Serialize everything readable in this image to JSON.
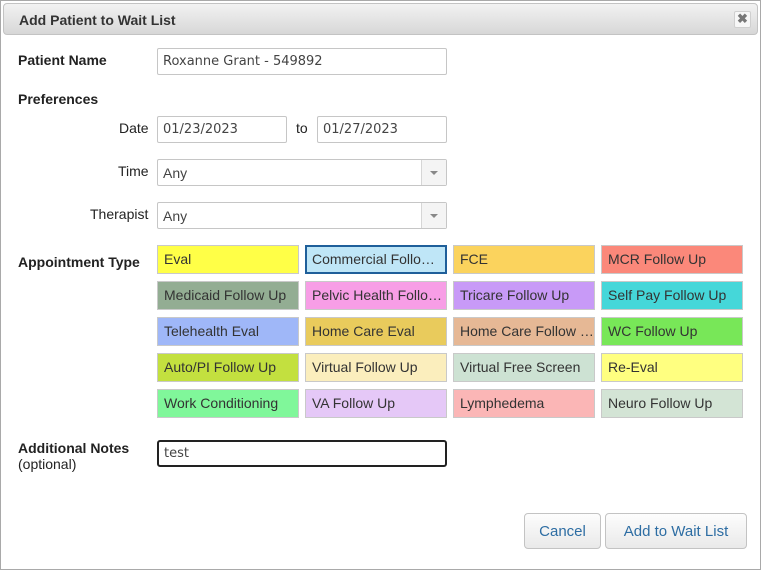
{
  "dialog": {
    "title": "Add Patient to Wait List",
    "close_glyph": "✖"
  },
  "patient": {
    "label": "Patient Name",
    "value": "Roxanne Grant - 549892"
  },
  "preferences": {
    "heading": "Preferences",
    "date_label": "Date",
    "date_from": "01/23/2023",
    "date_sep": "to",
    "date_to": "01/27/2023",
    "time_label": "Time",
    "time_value": "Any",
    "therapist_label": "Therapist",
    "therapist_value": "Any"
  },
  "appointment": {
    "label": "Appointment Type",
    "selected": "Commercial Follow Up",
    "types": [
      {
        "label": "Eval",
        "color": "#ffff47"
      },
      {
        "label": "Commercial Follow Up",
        "color": "#bfe6f7"
      },
      {
        "label": "FCE",
        "color": "#fbd35d"
      },
      {
        "label": "MCR Follow Up",
        "color": "#fb887a"
      },
      {
        "label": "Medicaid Follow Up",
        "color": "#93ad93"
      },
      {
        "label": "Pelvic Health Follow Up",
        "color": "#f79ee6"
      },
      {
        "label": "Tricare Follow Up",
        "color": "#c89af7"
      },
      {
        "label": "Self Pay Follow Up",
        "color": "#45d7d9"
      },
      {
        "label": "Telehealth Eval",
        "color": "#9fb7f8"
      },
      {
        "label": "Home Care Eval",
        "color": "#e9cb5c"
      },
      {
        "label": "Home Care Follow Up",
        "color": "#e6b895"
      },
      {
        "label": "WC Follow Up",
        "color": "#78e758"
      },
      {
        "label": "Auto/PI Follow Up",
        "color": "#c3e03f"
      },
      {
        "label": "Virtual Follow Up",
        "color": "#fbeebd"
      },
      {
        "label": "Virtual Free Screen",
        "color": "#cde2d3"
      },
      {
        "label": "Re-Eval",
        "color": "#ffff80"
      },
      {
        "label": "Work Conditioning",
        "color": "#80f79a"
      },
      {
        "label": "VA Follow Up",
        "color": "#e5c8f7"
      },
      {
        "label": "Lymphedema",
        "color": "#fbb6b6"
      },
      {
        "label": "Neuro Follow Up",
        "color": "#d3e4d5"
      }
    ]
  },
  "notes": {
    "label": "Additional Notes",
    "sublabel": "(optional)",
    "value": "test"
  },
  "buttons": {
    "cancel": "Cancel",
    "submit": "Add to Wait List"
  }
}
